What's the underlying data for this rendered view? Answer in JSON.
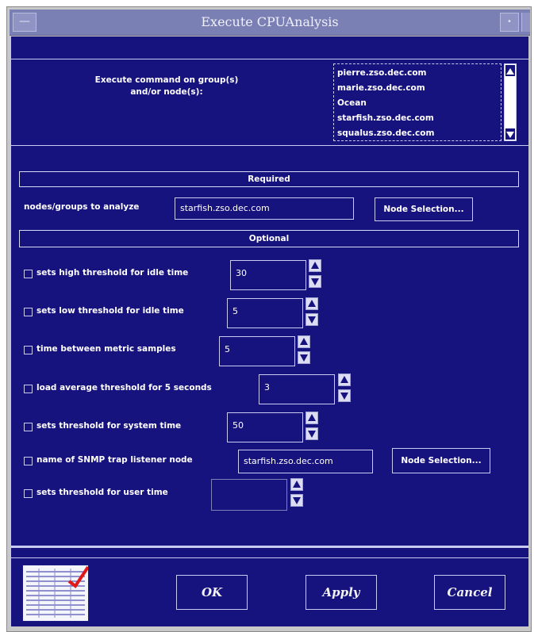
{
  "window": {
    "title": "Execute CPUAnalysis",
    "menu_symbol": "—",
    "min_symbol": "•"
  },
  "target": {
    "label": "Execute command on group(s)\nand/or node(s):",
    "nodes": [
      "pierre.zso.dec.com",
      "marie.zso.dec.com",
      "Ocean",
      "starfish.zso.dec.com",
      "squalus.zso.dec.com"
    ]
  },
  "required": {
    "header": "Required",
    "field_label": "nodes/groups to analyze",
    "field_value": "starfish.zso.dec.com",
    "button": "Node Selection..."
  },
  "optional": {
    "header": "Optional",
    "options": [
      {
        "label": "sets high threshold for idle time",
        "value": "30"
      },
      {
        "label": "sets low threshold for idle time",
        "value": "5"
      },
      {
        "label": "time between metric samples",
        "value": "5"
      },
      {
        "label": "load average threshold for 5 seconds",
        "value": "3"
      },
      {
        "label": "sets threshold for system time",
        "value": "50"
      },
      {
        "label": "name of SNMP trap listener node",
        "value": "starfish.zso.dec.com",
        "button": "Node Selection..."
      },
      {
        "label": "sets threshold for user time",
        "value": ""
      }
    ]
  },
  "buttons": {
    "ok": "OK",
    "apply": "Apply",
    "cancel": "Cancel"
  },
  "colors": {
    "background": "#16127e",
    "title_bar": "#7a7fb4",
    "text": "#ffffff"
  }
}
